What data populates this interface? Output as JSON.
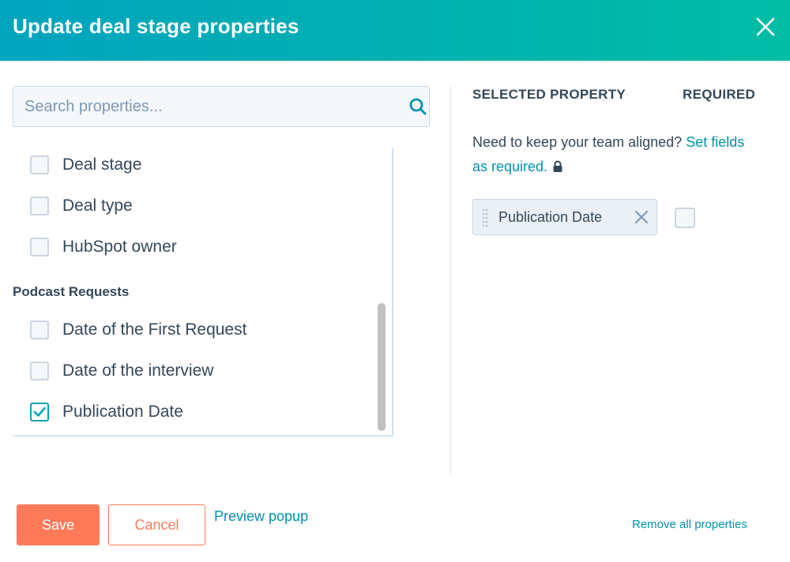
{
  "header": {
    "title": "Update deal stage properties",
    "close_icon": "close-icon",
    "colors": {
      "gradient_start": "#00a4bd",
      "gradient_end": "#00bda5"
    }
  },
  "search": {
    "placeholder": "Search properties...",
    "value": "",
    "icon": "search-icon"
  },
  "property_list": {
    "items_top": [
      {
        "label": "Deal stage",
        "checked": false
      },
      {
        "label": "Deal type",
        "checked": false
      },
      {
        "label": "HubSpot owner",
        "checked": false
      }
    ],
    "group": {
      "heading": "Podcast Requests",
      "items": [
        {
          "label": "Date of the First Request",
          "checked": false
        },
        {
          "label": "Date of the interview",
          "checked": false
        },
        {
          "label": "Publication Date",
          "checked": true
        }
      ]
    }
  },
  "selected_panel": {
    "column_selected": "SELECTED PROPERTY",
    "column_required": "REQUIRED",
    "hint_text": "Need to keep your team aligned? ",
    "hint_link": "Set fields as required.",
    "lock_icon": "lock-icon",
    "selected_items": [
      {
        "label": "Publication Date",
        "required": false
      }
    ]
  },
  "footer": {
    "save_label": "Save",
    "cancel_label": "Cancel",
    "preview_label": "Preview popup",
    "remove_all_label": "Remove all properties"
  },
  "colors": {
    "accent": "#0091ae",
    "primary_button": "#ff7a59",
    "checkbox_checked": "#00a4bd",
    "text": "#33475b"
  }
}
